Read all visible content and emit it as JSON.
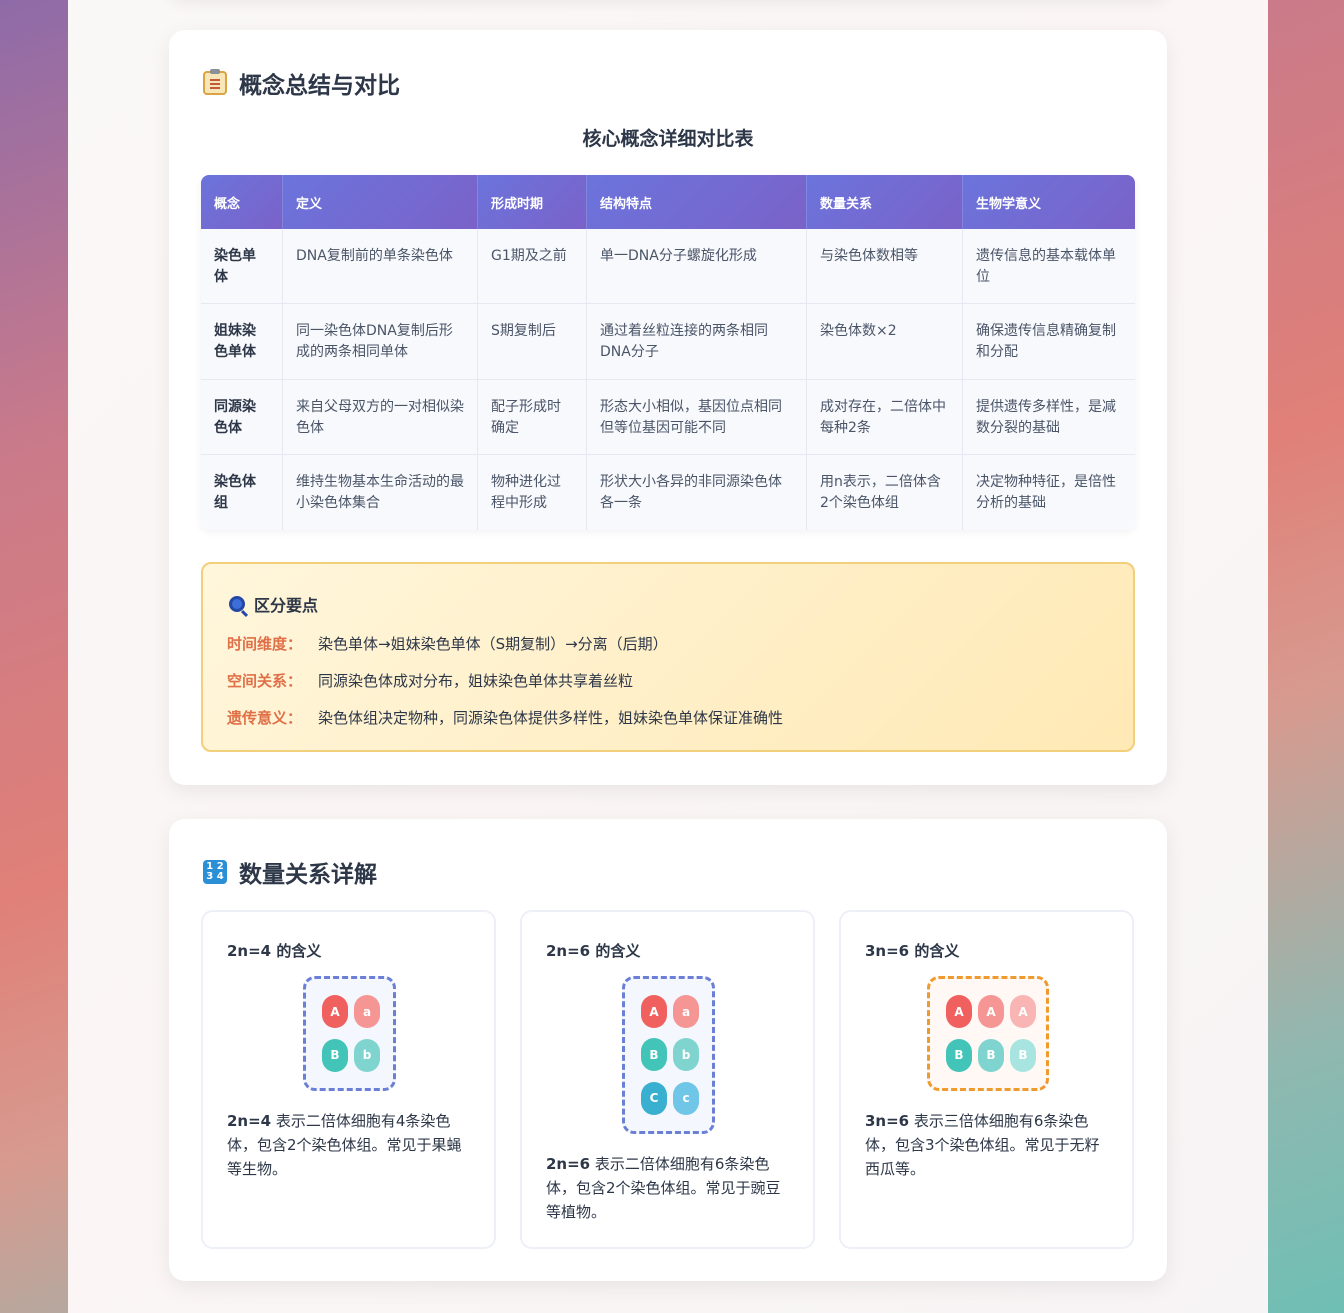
{
  "summary": {
    "title": "概念总结与对比",
    "table_title": "核心概念详细对比表",
    "headers": [
      "概念",
      "定义",
      "形成时期",
      "结构特点",
      "数量关系",
      "生物学意义"
    ],
    "rows": [
      [
        "染色单体",
        "DNA复制前的单条染色体",
        "G1期及之前",
        "单一DNA分子螺旋化形成",
        "与染色体数相等",
        "遗传信息的基本载体单位"
      ],
      [
        "姐妹染色单体",
        "同一染色体DNA复制后形成的两条相同单体",
        "S期复制后",
        "通过着丝粒连接的两条相同DNA分子",
        "染色体数×2",
        "确保遗传信息精确复制和分配"
      ],
      [
        "同源染色体",
        "来自父母双方的一对相似染色体",
        "配子形成时确定",
        "形态大小相似，基因位点相同但等位基因可能不同",
        "成对存在，二倍体中每种2条",
        "提供遗传多样性，是减数分裂的基础"
      ],
      [
        "染色体组",
        "维持生物基本生命活动的最小染色体集合",
        "物种进化过程中形成",
        "形状大小各异的非同源染色体各一条",
        "用n表示，二倍体含2个染色体组",
        "决定物种特征，是倍性分析的基础"
      ]
    ],
    "tips": {
      "title": "区分要点",
      "items": [
        {
          "label": "时间维度：",
          "text": "染色单体→姐妹染色单体（S期复制）→分离（后期）"
        },
        {
          "label": "空间关系：",
          "text": "同源染色体成对分布，姐妹染色单体共享着丝粒"
        },
        {
          "label": "遗传意义：",
          "text": "染色体组决定物种，同源染色体提供多样性，姐妹染色单体保证准确性"
        }
      ]
    }
  },
  "quantity": {
    "title": "数量关系详解",
    "icon_text": "1 2 3 4",
    "cards": [
      {
        "title": "2n=4 的含义",
        "chromosomes": [
          [
            "A",
            "a"
          ],
          [
            "B",
            "b"
          ]
        ],
        "desc_bold": "2n=4",
        "desc": " 表示二倍体细胞有4条染色体，包含2个染色体组。常见于果蝇等生物。"
      },
      {
        "title": "2n=6 的含义",
        "chromosomes": [
          [
            "A",
            "a"
          ],
          [
            "B",
            "b"
          ],
          [
            "C",
            "c"
          ]
        ],
        "desc_bold": "2n=6",
        "desc": " 表示二倍体细胞有6条染色体，包含2个染色体组。常见于豌豆等植物。"
      },
      {
        "title": "3n=6 的含义",
        "chromosomes": [
          [
            "A",
            "A",
            "A"
          ],
          [
            "B",
            "B",
            "B"
          ]
        ],
        "desc_bold": "3n=6",
        "desc": " 表示三倍体细胞有6条染色体，包含3个染色体组。常见于无籽西瓜等。"
      }
    ]
  },
  "colors": {
    "table_header": "#6b74dc",
    "tip_label": "#e07048",
    "chrom_A": "#f0605e",
    "chrom_B": "#42c4b8",
    "box_blue": "#6b7fd6",
    "box_orange": "#ef9a2d"
  }
}
